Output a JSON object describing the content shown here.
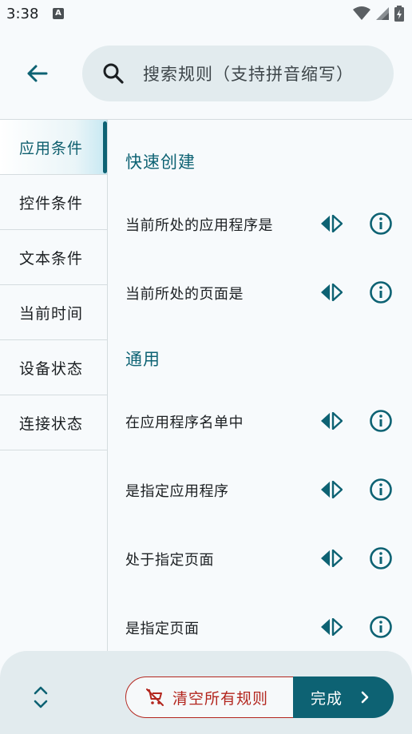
{
  "status_bar": {
    "time": "3:38",
    "notification_icon": "A"
  },
  "search": {
    "placeholder": "搜索规则（支持拼音缩写）"
  },
  "sidebar": {
    "items": [
      {
        "label": "应用条件",
        "active": true
      },
      {
        "label": "控件条件",
        "active": false
      },
      {
        "label": "文本条件",
        "active": false
      },
      {
        "label": "当前时间",
        "active": false
      },
      {
        "label": "设备状态",
        "active": false
      },
      {
        "label": "连接状态",
        "active": false
      }
    ]
  },
  "content": {
    "sections": [
      {
        "title": "快速创建",
        "items": [
          "当前所处的应用程序是",
          "当前所处的页面是"
        ]
      },
      {
        "title": "通用",
        "items": [
          "在应用程序名单中",
          "是指定应用程序",
          "处于指定页面",
          "是指定页面"
        ]
      }
    ],
    "row_icons": [
      "swap-icon",
      "info-icon"
    ]
  },
  "bottom_bar": {
    "clear_label": "清空所有规则",
    "done_label": "完成"
  },
  "colors": {
    "accent": "#0d6273",
    "danger": "#b3261e",
    "surface": "#e2ebee",
    "background": "#f7fafc"
  }
}
